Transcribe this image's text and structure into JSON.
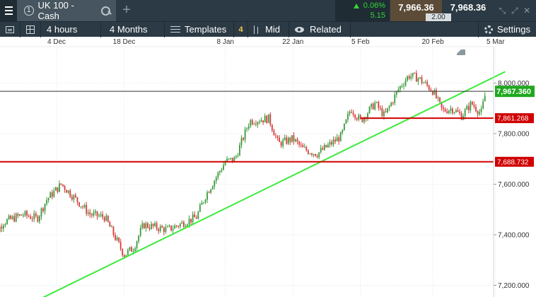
{
  "header": {
    "menu_icon": "hamburger-icon",
    "instrument_number": "1",
    "instrument_name": "UK 100 - Cash",
    "search_icon": "search-icon",
    "add_tab_symbol": "+",
    "change_pct": "0.06%",
    "change_abs": "5.15",
    "sell_price": "7,966.36",
    "buy_price": "7,968.36",
    "spread": "2.00",
    "window_controls": [
      "⤡",
      "⤢",
      "✕"
    ]
  },
  "toolbar": {
    "interval": "4 hours",
    "range": "4 Months",
    "templates_label": "Templates",
    "templates_count": "4",
    "mid_label": "Mid",
    "related_label": "Related",
    "settings_label": "Settings"
  },
  "colors": {
    "up": "#3a9a3a",
    "down": "#d63a3a",
    "trendline": "#3cea3c",
    "level_line": "#d10000",
    "current_price": "#1fa81f"
  },
  "chart_data": {
    "type": "candlestick",
    "x_axis_labels": [
      "4 Dec",
      "18 Dec",
      "8 Jan",
      "22 Jan",
      "5 Feb",
      "20 Feb",
      "5 Mar"
    ],
    "y_axis_labels": [
      "8,000.000",
      "7,800.000",
      "7,600.000",
      "7,400.000",
      "7,200.000"
    ],
    "ylim": [
      7170,
      8090
    ],
    "current_price_label": "7,967.360",
    "current_price": 7967.36,
    "levels": [
      {
        "label": "7,861.268",
        "value": 7861.268
      },
      {
        "label": "7,688.732",
        "value": 7688.732
      }
    ],
    "trendline": {
      "from": {
        "x": "1 Dec",
        "y": 7150
      },
      "to": {
        "x": "7 Mar",
        "y": 8045
      }
    },
    "price_anchors": [
      {
        "x": "20 Nov",
        "close": 7370
      },
      {
        "x": "23 Nov",
        "close": 7450
      },
      {
        "x": "27 Nov",
        "close": 7480
      },
      {
        "x": "30 Nov",
        "close": 7465
      },
      {
        "x": "2 Dec",
        "close": 7540
      },
      {
        "x": "5 Dec",
        "close": 7600
      },
      {
        "x": "7 Dec",
        "close": 7560
      },
      {
        "x": "11 Dec",
        "close": 7480
      },
      {
        "x": "14 Dec",
        "close": 7470
      },
      {
        "x": "18 Dec",
        "close": 7320
      },
      {
        "x": "20 Dec",
        "close": 7350
      },
      {
        "x": "22 Dec",
        "close": 7440
      },
      {
        "x": "27 Dec",
        "close": 7420
      },
      {
        "x": "2 Jan",
        "close": 7470
      },
      {
        "x": "4 Jan",
        "close": 7560
      },
      {
        "x": "8 Jan",
        "close": 7690
      },
      {
        "x": "10 Jan",
        "close": 7700
      },
      {
        "x": "13 Jan",
        "close": 7850
      },
      {
        "x": "17 Jan",
        "close": 7860
      },
      {
        "x": "19 Jan",
        "close": 7760
      },
      {
        "x": "22 Jan",
        "close": 7780
      },
      {
        "x": "24 Jan",
        "close": 7740
      },
      {
        "x": "27 Jan",
        "close": 7720
      },
      {
        "x": "1 Feb",
        "close": 7790
      },
      {
        "x": "3 Feb",
        "close": 7900
      },
      {
        "x": "5 Feb",
        "close": 7850
      },
      {
        "x": "8 Feb",
        "close": 7920
      },
      {
        "x": "10 Feb",
        "close": 7870
      },
      {
        "x": "13 Feb",
        "close": 7980
      },
      {
        "x": "15 Feb",
        "close": 8030
      },
      {
        "x": "17 Feb",
        "close": 8020
      },
      {
        "x": "20 Feb",
        "close": 7970
      },
      {
        "x": "22 Feb",
        "close": 7890
      },
      {
        "x": "24 Feb",
        "close": 7900
      },
      {
        "x": "26 Feb",
        "close": 7870
      },
      {
        "x": "28 Feb",
        "close": 7920
      },
      {
        "x": "2 Mar",
        "close": 7880
      },
      {
        "x": "3 Mar",
        "close": 7967
      }
    ]
  }
}
